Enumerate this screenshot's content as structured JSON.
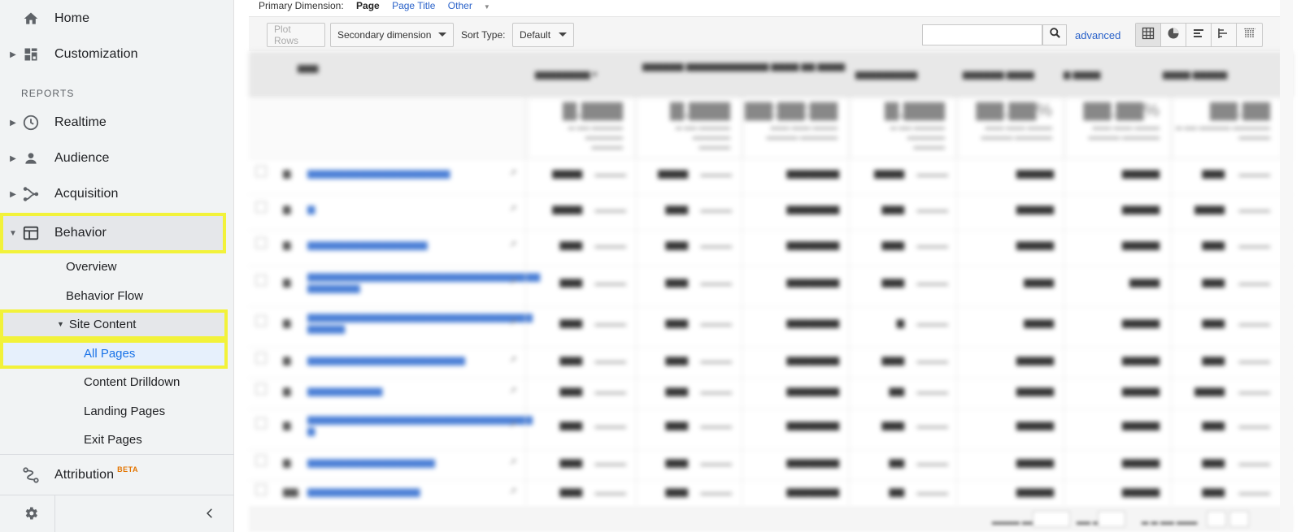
{
  "sidebar": {
    "home_label": "Home",
    "customization_label": "Customization",
    "reports_header": "REPORTS",
    "realtime_label": "Realtime",
    "audience_label": "Audience",
    "acquisition_label": "Acquisition",
    "behavior_label": "Behavior",
    "overview_label": "Overview",
    "behavior_flow_label": "Behavior Flow",
    "site_content_label": "Site Content",
    "all_pages_label": "All Pages",
    "content_drilldown_label": "Content Drilldown",
    "landing_pages_label": "Landing Pages",
    "exit_pages_label": "Exit Pages",
    "attribution_label": "Attribution",
    "attribution_badge": "BETA",
    "highlight_color": "#f2f23a",
    "icons": [
      "home-icon",
      "dashboard-icon",
      "clock-icon",
      "person-icon",
      "acquisition-icon",
      "behavior-icon",
      "attribution-icon",
      "gear-icon",
      "chevron-left-icon"
    ]
  },
  "report": {
    "primary_dimension_label": "Primary Dimension:",
    "dim_page": "Page",
    "dim_page_title": "Page Title",
    "dim_other": "Other",
    "plot_rows": "Plot Rows",
    "secondary_dimension": "Secondary dimension",
    "sort_type_label": "Sort Type:",
    "sort_type_value": "Default",
    "search_value": "",
    "advanced": "advanced",
    "link_color": "#2a62c9"
  }
}
